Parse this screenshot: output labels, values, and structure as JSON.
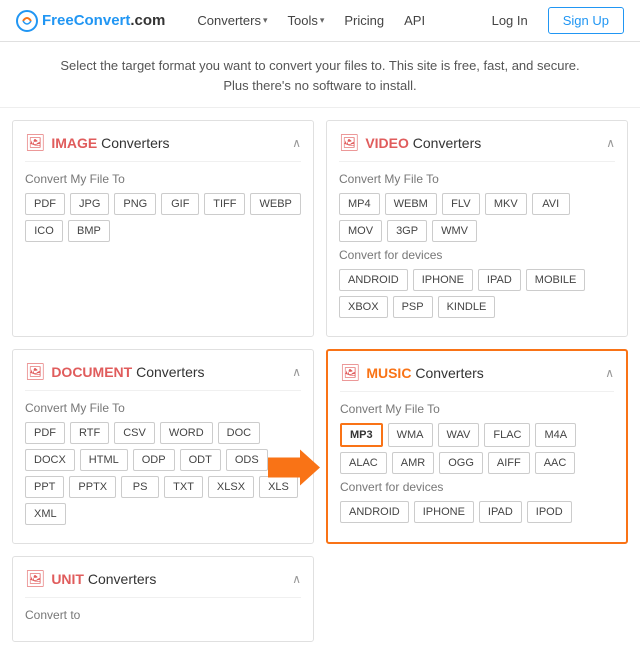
{
  "nav": {
    "logo_free": "Free",
    "logo_convert": "Convert",
    "logo_com": ".com",
    "links": [
      {
        "label": "Converters",
        "has_arrow": true
      },
      {
        "label": "Tools",
        "has_arrow": true
      },
      {
        "label": "Pricing",
        "has_arrow": false
      },
      {
        "label": "API",
        "has_arrow": false
      }
    ],
    "login": "Log In",
    "signup": "Sign Up"
  },
  "subtitle": "Select the target format you want to convert your files to. This site is free, fast, and secure. Plus\nthere's no software to install.",
  "cards": {
    "image": {
      "title_bold": "IMAGE",
      "title_rest": " Converters",
      "section_label": "Convert My File To",
      "formats": [
        "PDF",
        "JPG",
        "PNG",
        "GIF",
        "TIFF",
        "WEBP",
        "ICO",
        "BMP"
      ]
    },
    "video": {
      "title_bold": "VIDEO",
      "title_rest": " Converters",
      "section_label": "Convert My File To",
      "formats": [
        "MP4",
        "WEBM",
        "FLV",
        "MKV",
        "AVI",
        "MOV",
        "3GP",
        "WMV"
      ],
      "device_label": "Convert for devices",
      "devices": [
        "ANDROID",
        "IPHONE",
        "IPAD",
        "MOBILE",
        "XBOX",
        "PSP",
        "KINDLE"
      ]
    },
    "document": {
      "title_bold": "DOCUMENT",
      "title_rest": " Converters",
      "section_label": "Convert My File To",
      "formats": [
        "PDF",
        "RTF",
        "CSV",
        "WORD",
        "DOC",
        "DOCX",
        "HTML",
        "ODP",
        "ODT",
        "ODS",
        "PPT",
        "PPTX",
        "PS",
        "TXT",
        "XLSX",
        "XLS",
        "XML"
      ]
    },
    "music": {
      "title_bold": "MUSIC",
      "title_rest": " Converters",
      "section_label": "Convert My File To",
      "formats": [
        "MP3",
        "WMA",
        "WAV",
        "FLAC",
        "M4A",
        "ALAC",
        "AMR",
        "OGG",
        "AIFF",
        "AAC"
      ],
      "device_label": "Convert for devices",
      "devices": [
        "ANDROID",
        "IPHONE",
        "IPAD",
        "IPOD"
      ],
      "highlighted_format": "MP3"
    },
    "unit": {
      "title_bold": "UNIT",
      "title_rest": " Converters",
      "section_label": "Convert to"
    }
  }
}
